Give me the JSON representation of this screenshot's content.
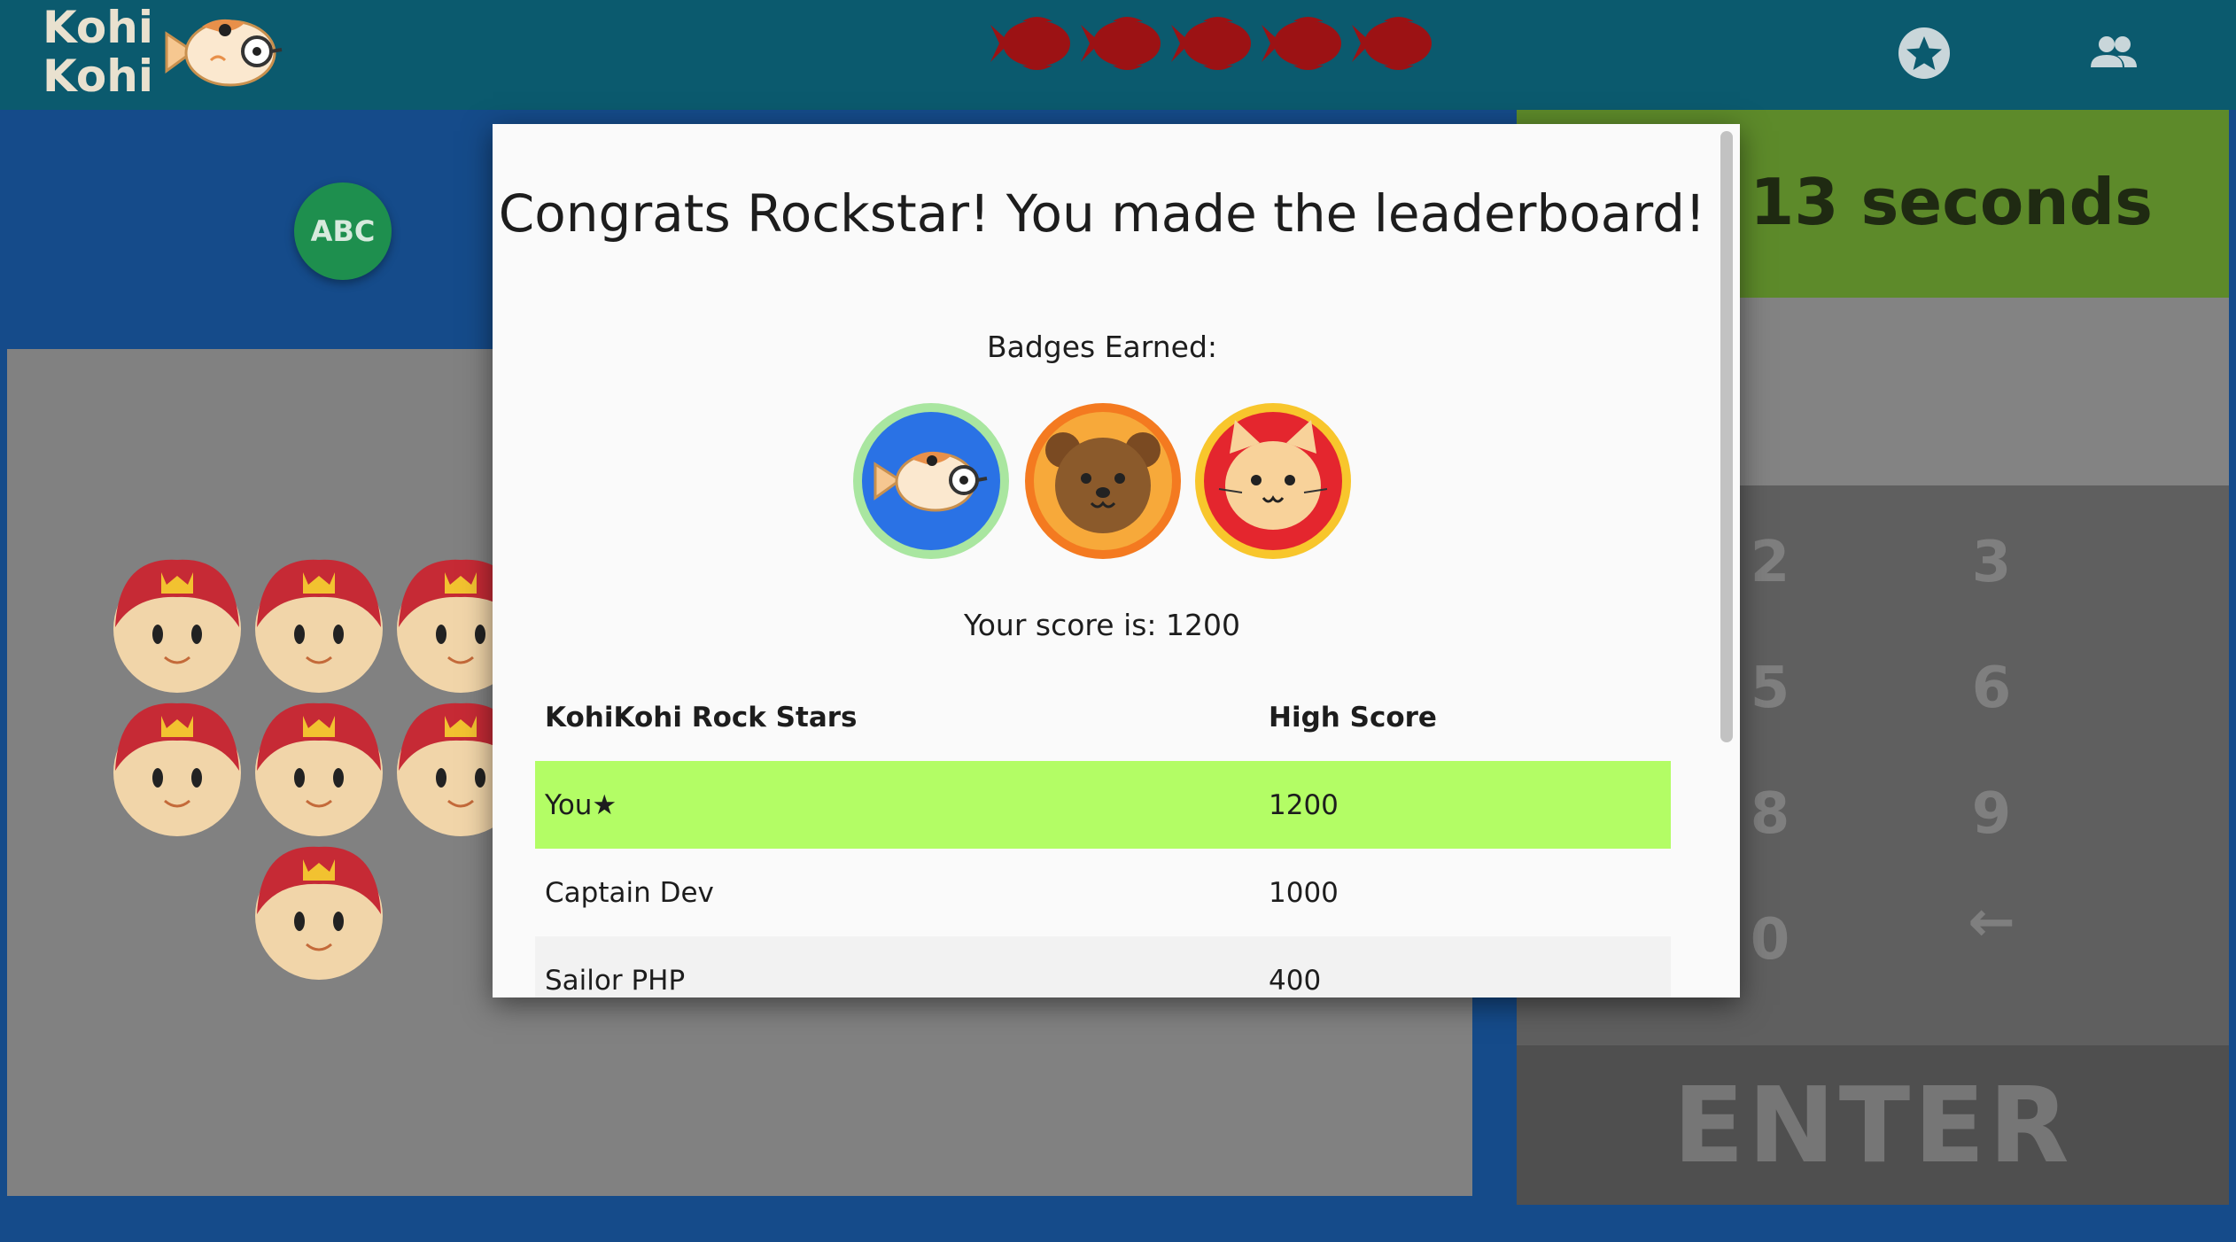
{
  "app": {
    "logo_text_line1": "Kohi",
    "logo_text_line2": "Kohi",
    "lives_count": 5,
    "icons": [
      "star-circle-icon",
      "users-icon"
    ],
    "colors": {
      "topbar": "#0b5a6e",
      "background": "#154b8a",
      "life": "#9c1214",
      "timer": "#5d8a2a",
      "highlight_row": "#b3fd65"
    }
  },
  "game": {
    "abc_label": "ABC",
    "timer_text": "13 seconds",
    "keypad": [
      "2",
      "3",
      "5",
      "6",
      "8",
      "9",
      "0",
      "←"
    ],
    "enter_label": "ENTER"
  },
  "modal": {
    "title": "Congrats Rockstar! You made the leaderboard!",
    "badges_label": "Badges Earned:",
    "badges": [
      "fish-badge-icon",
      "bear-badge-icon",
      "cat-badge-icon"
    ],
    "score_text": "Your score is: 1200",
    "leaderboard": {
      "headers": [
        "KohiKohi Rock Stars",
        "High Score"
      ],
      "rows": [
        {
          "name": "You★",
          "score": "1200"
        },
        {
          "name": "Captain Dev",
          "score": "1000"
        },
        {
          "name": "Sailor PHP",
          "score": "400"
        }
      ]
    }
  }
}
